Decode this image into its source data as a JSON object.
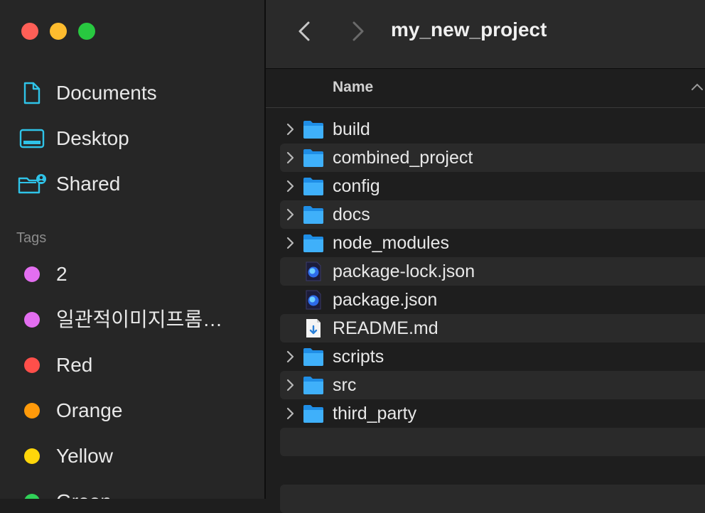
{
  "window": {
    "title": "my_new_project"
  },
  "colors": {
    "sidebar_bg": "#262626",
    "main_bg": "#1e1e1e",
    "row_alt_bg": "#2a2a2a",
    "accent_cyan": "#2fc3e8",
    "folder_blue": "#2a9df4"
  },
  "sidebar": {
    "favorites": [
      {
        "label": "Documents",
        "icon": "document-icon"
      },
      {
        "label": "Desktop",
        "icon": "desktop-icon"
      },
      {
        "label": "Shared",
        "icon": "shared-folder-icon"
      }
    ],
    "tags_title": "Tags",
    "tags": [
      {
        "label": "2",
        "color": "#e36ef0"
      },
      {
        "label": "일관적이미지프롬…",
        "color": "#e36ef0"
      },
      {
        "label": "Red",
        "color": "#ff4f4a"
      },
      {
        "label": "Orange",
        "color": "#ff9a0a"
      },
      {
        "label": "Yellow",
        "color": "#ffd60a"
      },
      {
        "label": "Green",
        "color": "#30d158"
      }
    ]
  },
  "list": {
    "column_name": "Name",
    "sort": "ascending",
    "items": [
      {
        "name": "build",
        "kind": "folder"
      },
      {
        "name": "combined_project",
        "kind": "folder"
      },
      {
        "name": "config",
        "kind": "folder"
      },
      {
        "name": "docs",
        "kind": "folder"
      },
      {
        "name": "node_modules",
        "kind": "folder"
      },
      {
        "name": "package-lock.json",
        "kind": "json"
      },
      {
        "name": "package.json",
        "kind": "json"
      },
      {
        "name": "README.md",
        "kind": "markdown"
      },
      {
        "name": "scripts",
        "kind": "folder"
      },
      {
        "name": "src",
        "kind": "folder"
      },
      {
        "name": "third_party",
        "kind": "folder"
      }
    ]
  }
}
